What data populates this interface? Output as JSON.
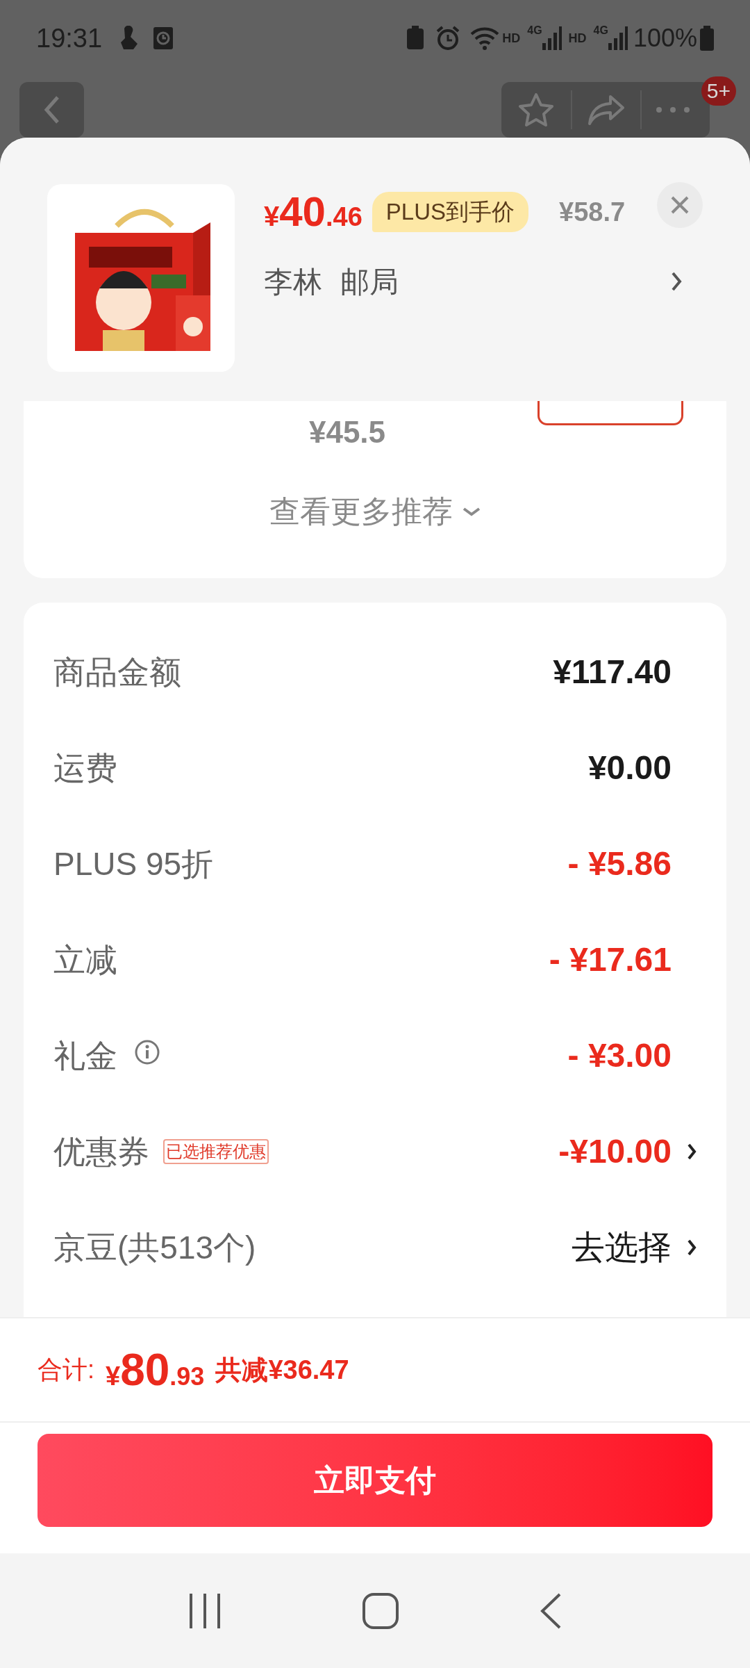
{
  "status_bar": {
    "time": "19:31",
    "network_labels": [
      "HD",
      "4G",
      "HD",
      "4G"
    ],
    "battery": "100%"
  },
  "header": {
    "badge": "5+"
  },
  "product": {
    "price_symbol": "¥",
    "price_int": "40",
    "price_dec": ".46",
    "plus_tag": "PLUS到手价",
    "original_price": "¥58.7",
    "address": [
      "李林",
      "邮局"
    ]
  },
  "recommendation": {
    "price": "¥45.5",
    "more_link": "查看更多推荐"
  },
  "summary": {
    "rows": [
      {
        "label": "商品金额",
        "value": "¥117.40",
        "kind": "amount",
        "info": false,
        "arrow": false
      },
      {
        "label": "运费",
        "value": "¥0.00",
        "kind": "amount",
        "info": false,
        "arrow": false
      },
      {
        "label": "PLUS 95折",
        "value": "- ¥5.86",
        "kind": "discount",
        "info": false,
        "arrow": false
      },
      {
        "label": "立减",
        "value": "- ¥17.61",
        "kind": "discount",
        "info": false,
        "arrow": false
      },
      {
        "label": "礼金",
        "value": "- ¥3.00",
        "kind": "discount",
        "info": true,
        "arrow": false
      },
      {
        "label": "优惠券",
        "tag": "已选推荐优惠",
        "value": "-¥10.00",
        "kind": "discount",
        "info": false,
        "arrow": true
      },
      {
        "label": "京豆(共513个)",
        "value": "去选择",
        "kind": "action",
        "info": false,
        "arrow": true
      }
    ]
  },
  "footer": {
    "total_label": "合计:",
    "total_symbol": "¥",
    "total_int": "80",
    "total_dec": ".93",
    "saved": "共减¥36.47",
    "pay_button": "立即支付"
  }
}
